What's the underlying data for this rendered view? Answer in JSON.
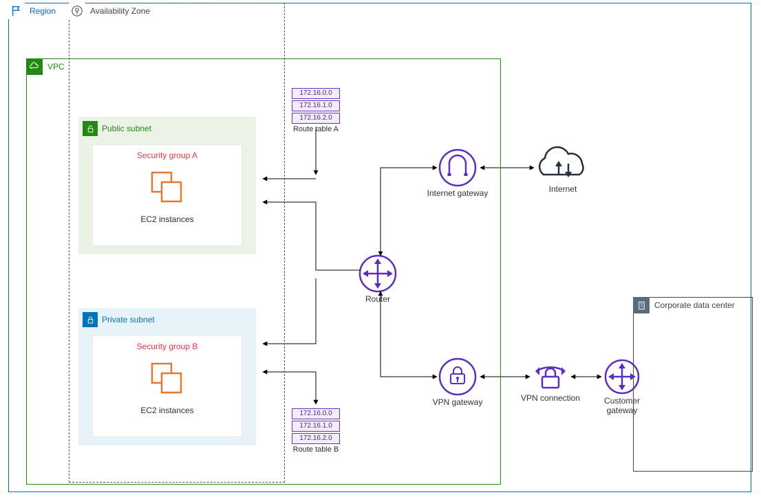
{
  "region": {
    "label": "Region"
  },
  "availability_zone": {
    "label": "Availability Zone"
  },
  "vpc": {
    "label": "VPC"
  },
  "corporate_dc": {
    "label": "Corporate data center"
  },
  "public_subnet": {
    "label": "Public subnet",
    "security_group": "Security group A",
    "ec2_label": "EC2 instances"
  },
  "private_subnet": {
    "label": "Private subnet",
    "security_group": "Security group B",
    "ec2_label": "EC2 instances"
  },
  "route_table_a": {
    "label": "Route table A",
    "rows": [
      "172.16.0.0",
      "172.16.1.0",
      "172.16.2.0"
    ]
  },
  "route_table_b": {
    "label": "Route table B",
    "rows": [
      "172.16.0.0",
      "172.16.1.0",
      "172.16.2.0"
    ]
  },
  "router": {
    "label": "Router"
  },
  "igw": {
    "label": "Internet gateway"
  },
  "vpngw": {
    "label": "VPN gateway"
  },
  "internet": {
    "label": "Internet"
  },
  "vpnconn": {
    "label": "VPN connection"
  },
  "cgw": {
    "label": "Customer gateway"
  }
}
